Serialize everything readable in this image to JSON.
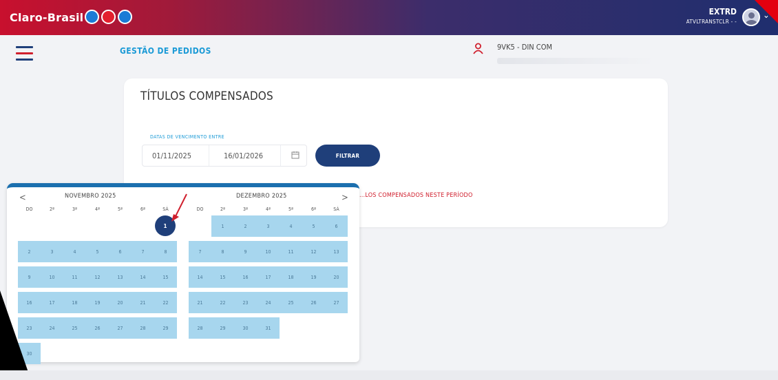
{
  "header": {
    "brand": "Claro-Brasil",
    "brand_icons": [
      {
        "name": "app-icon-1",
        "color": "#1b7bd6"
      },
      {
        "name": "app-icon-2",
        "color": "#e3202e"
      },
      {
        "name": "app-icon-3",
        "color": "#1b7bd6"
      }
    ],
    "user_code": "EXTRD",
    "user_subtitle": "ATVLTRANSTCLR - -"
  },
  "nav": {
    "page_title": "GESTÃO DE PEDIDOS",
    "store_name": "9VK5 - DIN COM"
  },
  "filter": {
    "card_title": "TÍTULOS COMPENSADOS",
    "date_label": "DATAS DE VENCIMENTO ENTRE",
    "start_date": "01/11/2025",
    "end_date": "16/01/2026",
    "filter_button": "FILTRAR",
    "no_results": "...LOS COMPENSADOS NESTE PERÍODO"
  },
  "datepicker": {
    "prev_label": "<",
    "next_label": ">",
    "weekdays": [
      "DO",
      "2ª",
      "3ª",
      "4ª",
      "5ª",
      "6ª",
      "SÁ"
    ],
    "months": [
      {
        "label": "NOVEMBRO 2025",
        "first_weekday": 6,
        "days": 30,
        "selected_day": 1
      },
      {
        "label": "DEZEMBRO 2025",
        "first_weekday": 1,
        "days": 31,
        "selected_day": null
      }
    ]
  },
  "colors": {
    "accent_blue": "#1b9ad6",
    "navy": "#1f3f7a",
    "range_cell": "#a7d6ee",
    "error_red": "#d0202e"
  }
}
